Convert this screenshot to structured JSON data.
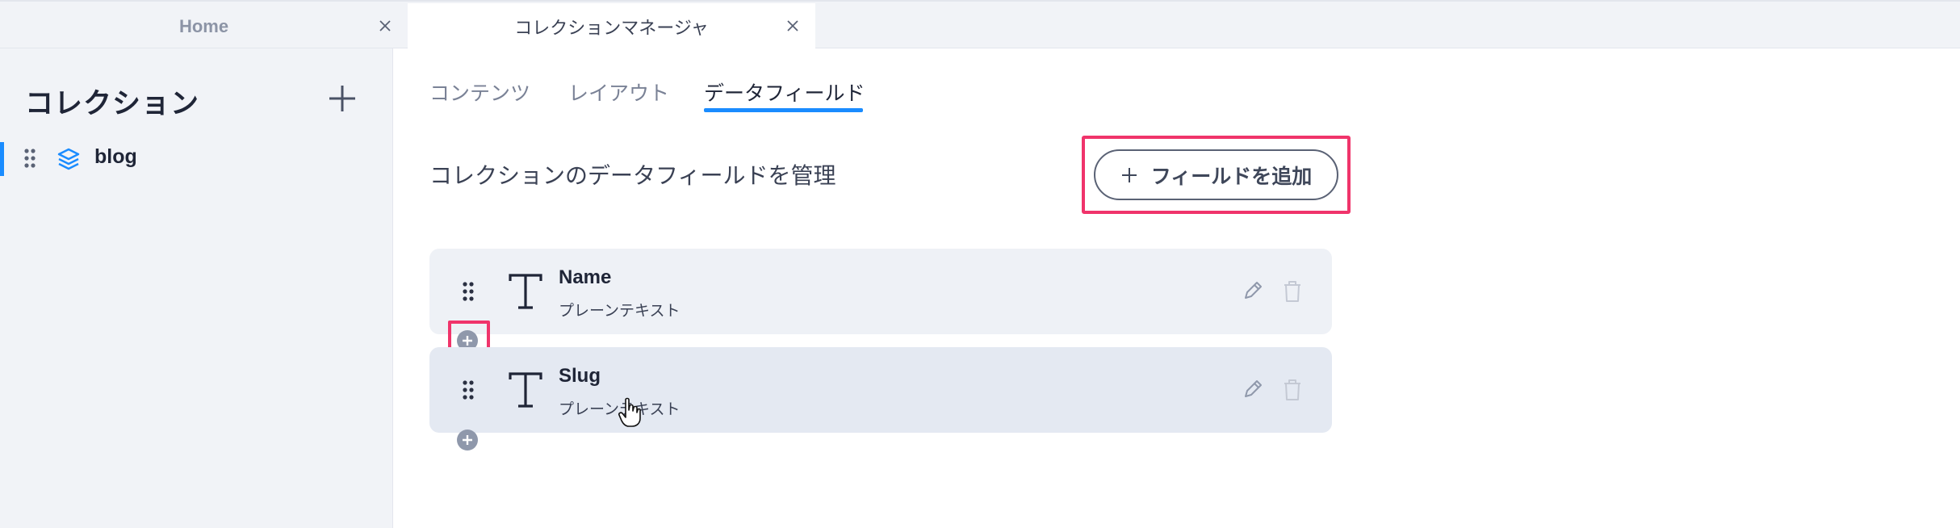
{
  "browser_tabs": [
    {
      "label": "Home",
      "active": false
    },
    {
      "label": "コレクションマネージャ",
      "active": true
    }
  ],
  "sidebar": {
    "title": "コレクション",
    "add_icon": "plus-icon",
    "items": [
      {
        "label": "blog",
        "icon": "layers-icon",
        "selected": true
      }
    ]
  },
  "main": {
    "tabs": [
      {
        "label": "コンテンツ",
        "active": false
      },
      {
        "label": "レイアウト",
        "active": false
      },
      {
        "label": "データフィールド",
        "active": true
      }
    ],
    "subtitle": "コレクションのデータフィールドを管理",
    "add_field_button": "フィールドを追加",
    "fields": [
      {
        "name": "Name",
        "type": "プレーンテキスト",
        "icon": "text-type-icon"
      },
      {
        "name": "Slug",
        "type": "プレーンテキスト",
        "icon": "text-type-icon"
      }
    ]
  },
  "colors": {
    "accent": "#1a8cff",
    "highlight": "#f0346b",
    "sidebar_bg": "#f1f3f7",
    "row_bg": "#eef1f6"
  }
}
